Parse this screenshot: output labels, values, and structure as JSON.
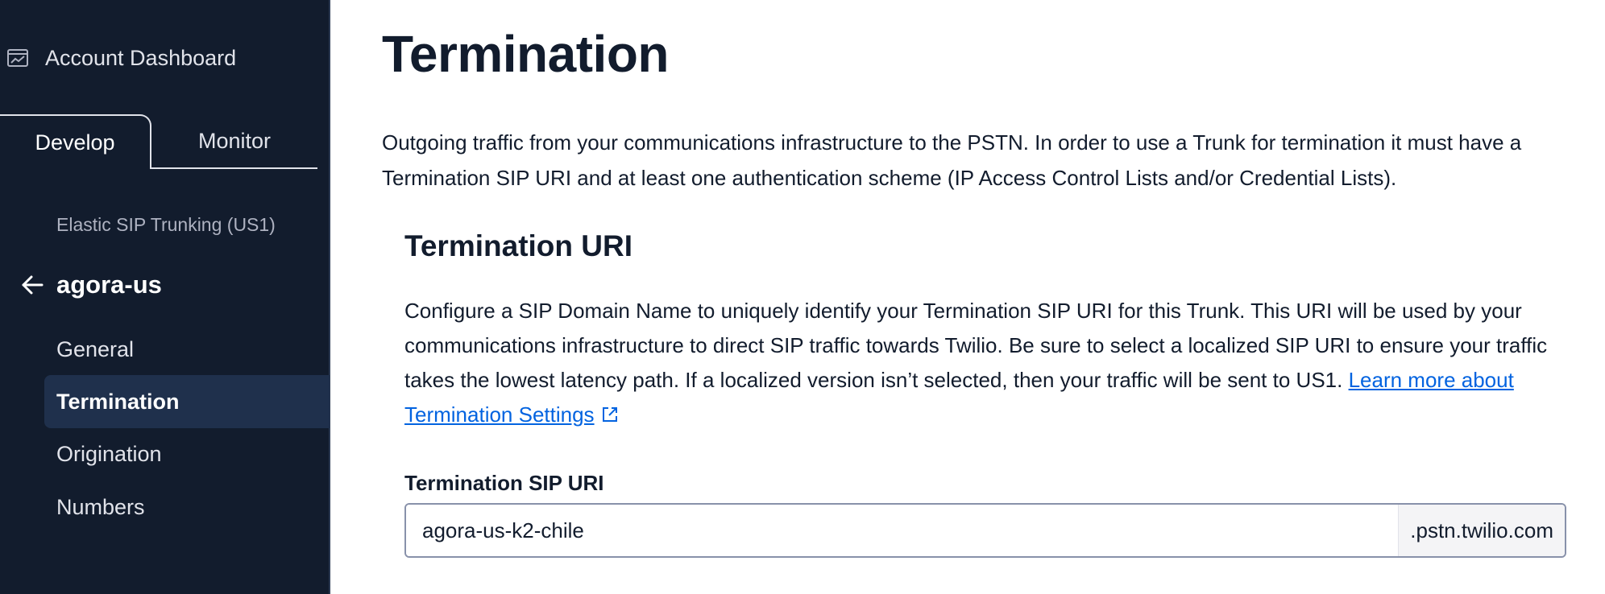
{
  "sidebar": {
    "account_dashboard_label": "Account Dashboard",
    "tabs": [
      {
        "label": "Develop",
        "active": true
      },
      {
        "label": "Monitor",
        "active": false
      }
    ],
    "service_label": "Elastic SIP Trunking (US1)",
    "trunk_name": "agora-us",
    "nav_items": [
      {
        "label": "General",
        "active": false
      },
      {
        "label": "Termination",
        "active": true
      },
      {
        "label": "Origination",
        "active": false
      },
      {
        "label": "Numbers",
        "active": false
      }
    ]
  },
  "main": {
    "title": "Termination",
    "intro": "Outgoing traffic from your communications infrastructure to the PSTN. In order to use a Trunk for termination it must have a Termination SIP URI and at least one authentication scheme (IP Access Control Lists and/or Credential Lists).",
    "section": {
      "title": "Termination URI",
      "description": "Configure a SIP Domain Name to uniquely identify your Termination SIP URI for this Trunk. This URI will be used by your communications infrastructure to direct SIP traffic towards Twilio. Be sure to select a localized SIP URI to ensure your traffic takes the lowest latency path. If a localized version isn’t selected, then your traffic will be sent to US1.",
      "link_text": "Learn more about Termination Settings",
      "field_label": "Termination SIP URI",
      "field_value": "agora-us-k2-chile",
      "field_suffix": ".pstn.twilio.com"
    }
  },
  "colors": {
    "sidebar_bg": "#121c2d",
    "active_nav_bg": "#1f304c",
    "link": "#0263e0",
    "text": "#121c2d"
  },
  "icons": {
    "account_dashboard": "chart-window-icon",
    "back": "arrow-left-icon",
    "external_link": "external-link-icon"
  }
}
